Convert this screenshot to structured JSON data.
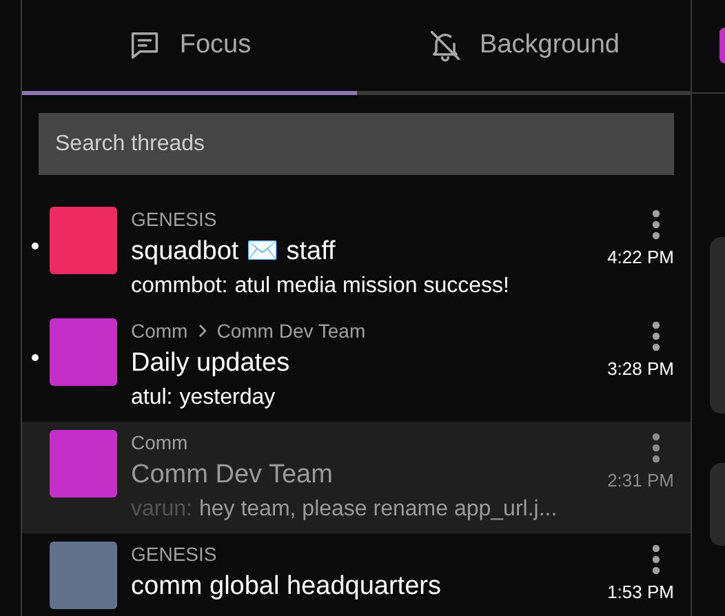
{
  "tabs": [
    {
      "label": "Focus",
      "kind": "focus",
      "selected": true
    },
    {
      "label": "Background",
      "kind": "background",
      "selected": false
    }
  ],
  "search": {
    "placeholder": "Search threads"
  },
  "threads": [
    {
      "unread": true,
      "selected": false,
      "color": "#ee2a63",
      "community": [
        "GENESIS"
      ],
      "title": "squadbot ✉️ staff",
      "author": "commbot:",
      "message": "atul media mission success!",
      "time": "4:22 PM"
    },
    {
      "unread": true,
      "selected": false,
      "color": "#c42fc8",
      "community": [
        "Comm",
        "Comm Dev Team"
      ],
      "title": "Daily updates",
      "author": "atul:",
      "message": "yesterday",
      "time": "3:28 PM"
    },
    {
      "unread": false,
      "selected": true,
      "color": "#c42fc8",
      "community": [
        "Comm"
      ],
      "title": "Comm Dev Team",
      "author": "varun:",
      "message": "hey team, please rename app_url.j...",
      "time": "2:31 PM"
    },
    {
      "unread": false,
      "selected": false,
      "color": "#62728d",
      "community": [
        "GENESIS"
      ],
      "title": "comm global headquarters",
      "time": "1:53 PM"
    }
  ]
}
